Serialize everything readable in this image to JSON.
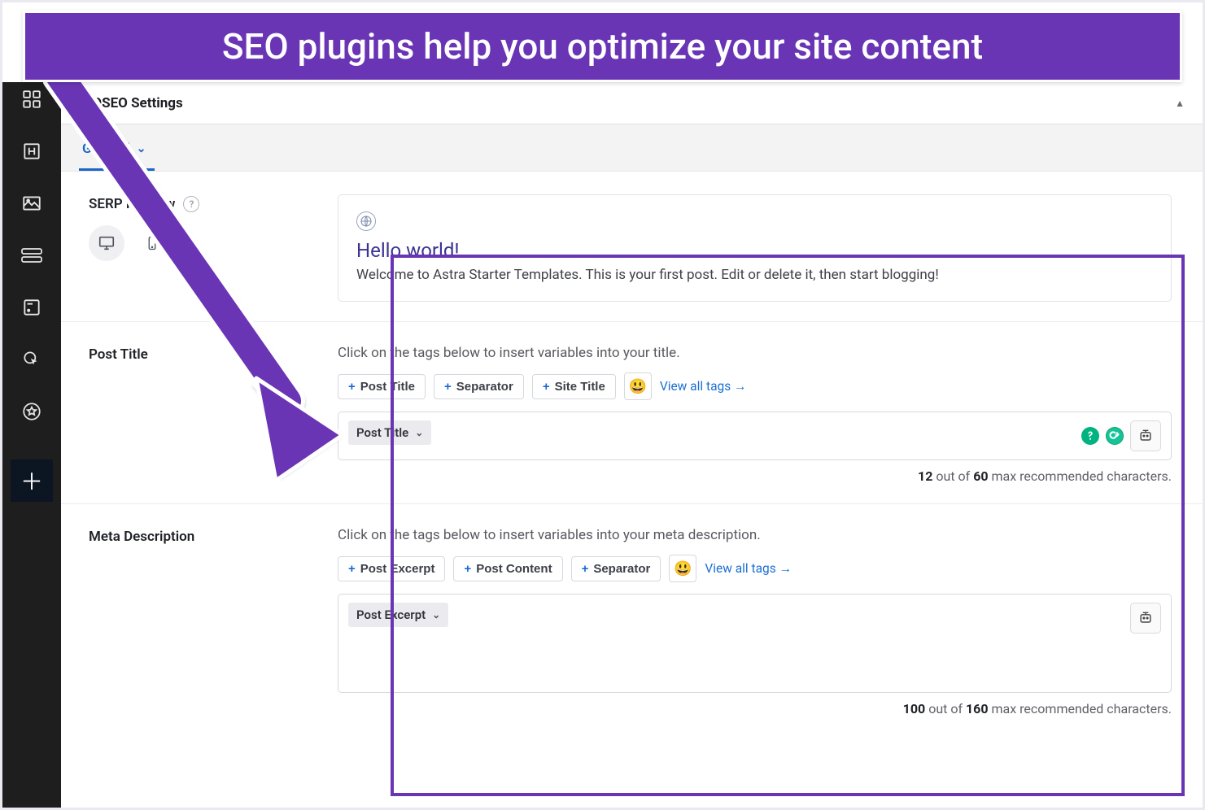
{
  "banner": {
    "text": "SEO plugins help you optimize your site content"
  },
  "panel": {
    "title": "AIOSEO Settings"
  },
  "tabs": {
    "active": "General"
  },
  "serp_section": {
    "label": "SERP Preview",
    "title": "Hello world!",
    "description": "Welcome to Astra Starter Templates. This is your first post. Edit or delete it, then start blogging!"
  },
  "post_title_section": {
    "label": "Post Title",
    "helper": "Click on the tags below to insert variables into your title.",
    "tags": [
      "Post Title",
      "Separator",
      "Site Title"
    ],
    "view_all": "View all tags →",
    "chip": "Post Title",
    "count_current": "12",
    "count_text_1": " out of ",
    "count_max": "60",
    "count_text_2": " max recommended characters."
  },
  "meta_section": {
    "label": "Meta Description",
    "helper": "Click on the tags below to insert variables into your meta description.",
    "tags": [
      "Post Excerpt",
      "Post Content",
      "Separator"
    ],
    "view_all": "View all tags →",
    "chip": "Post Excerpt",
    "count_current": "100",
    "count_text_1": " out of ",
    "count_max": "160",
    "count_text_2": " max recommended characters."
  }
}
